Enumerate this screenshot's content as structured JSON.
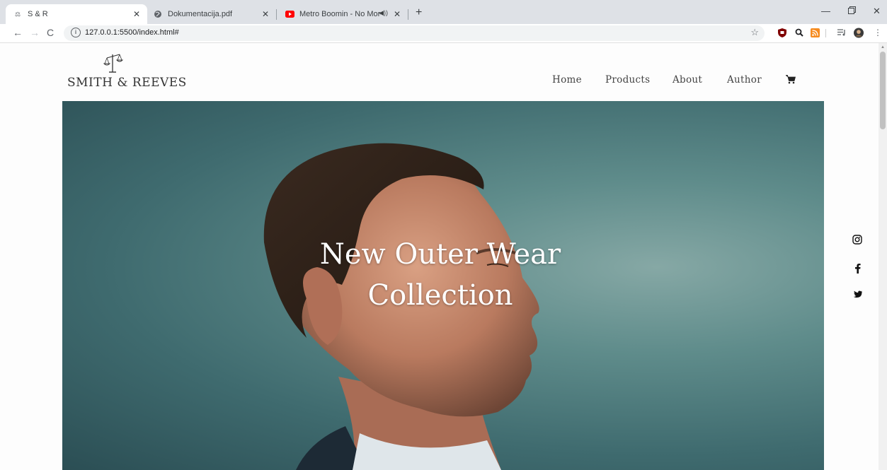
{
  "browser": {
    "tabs": [
      {
        "title": "S & R",
        "favicon": "scales-icon",
        "active": true
      },
      {
        "title": "Dokumentacija.pdf",
        "favicon": "globe-icon",
        "active": false
      },
      {
        "title": "Metro Boomin - No More [M",
        "favicon": "youtube-icon",
        "active": false,
        "audio": true
      }
    ],
    "url": "127.0.0.1:5500/index.html#",
    "colors": {
      "tabbar": "#dee1e6",
      "youtube": "#ff0000",
      "ublock": "#800000",
      "rss": "#f68b1f"
    }
  },
  "site": {
    "logo_text": "SMITH & REEVES",
    "logo_icon": "scales-of-justice-icon",
    "nav": {
      "home": "Home",
      "products": "Products",
      "about": "About",
      "author": "Author"
    },
    "cart_icon": "shopping-cart-icon",
    "hero": {
      "title_line1": "New Outer Wear",
      "title_line2": "Collection",
      "bg_color": "#5f8c8b"
    },
    "social": [
      "instagram-icon",
      "facebook-icon",
      "twitter-icon"
    ]
  }
}
